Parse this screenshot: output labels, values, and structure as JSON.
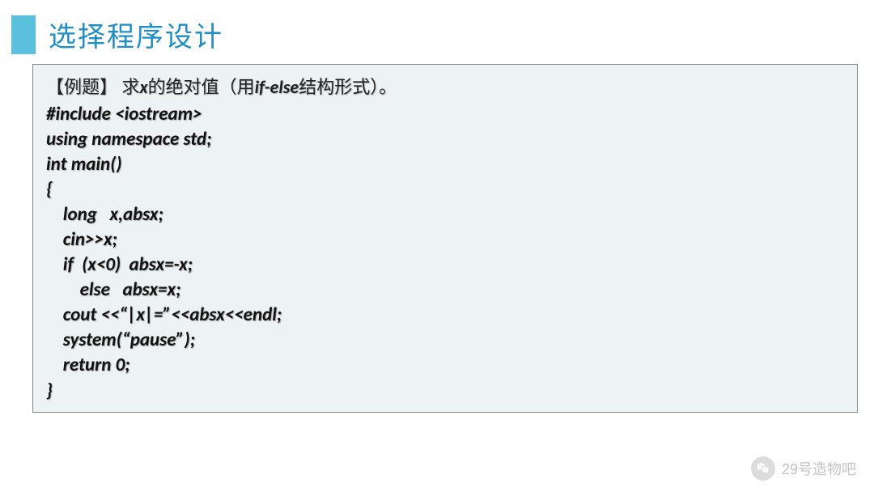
{
  "header": {
    "title": "选择程序设计"
  },
  "problem": {
    "prefix": "【例题】 求",
    "var": "x",
    "mid": "的绝对值（用",
    "struct": "if-else",
    "suffix": "结构形式）。"
  },
  "code_lines": [
    "#include <iostream>",
    "using namespace std;",
    "int main()",
    "{",
    "    long   x,absx;",
    "    cin>>x;",
    "    if  (x<0)  absx=-x;",
    "        else   absx=x;",
    "    cout <<“|x|=”<<absx<<endl;",
    "    system(“pause”);",
    "    return 0;",
    "}"
  ],
  "watermark": {
    "text": "29号造物吧"
  }
}
